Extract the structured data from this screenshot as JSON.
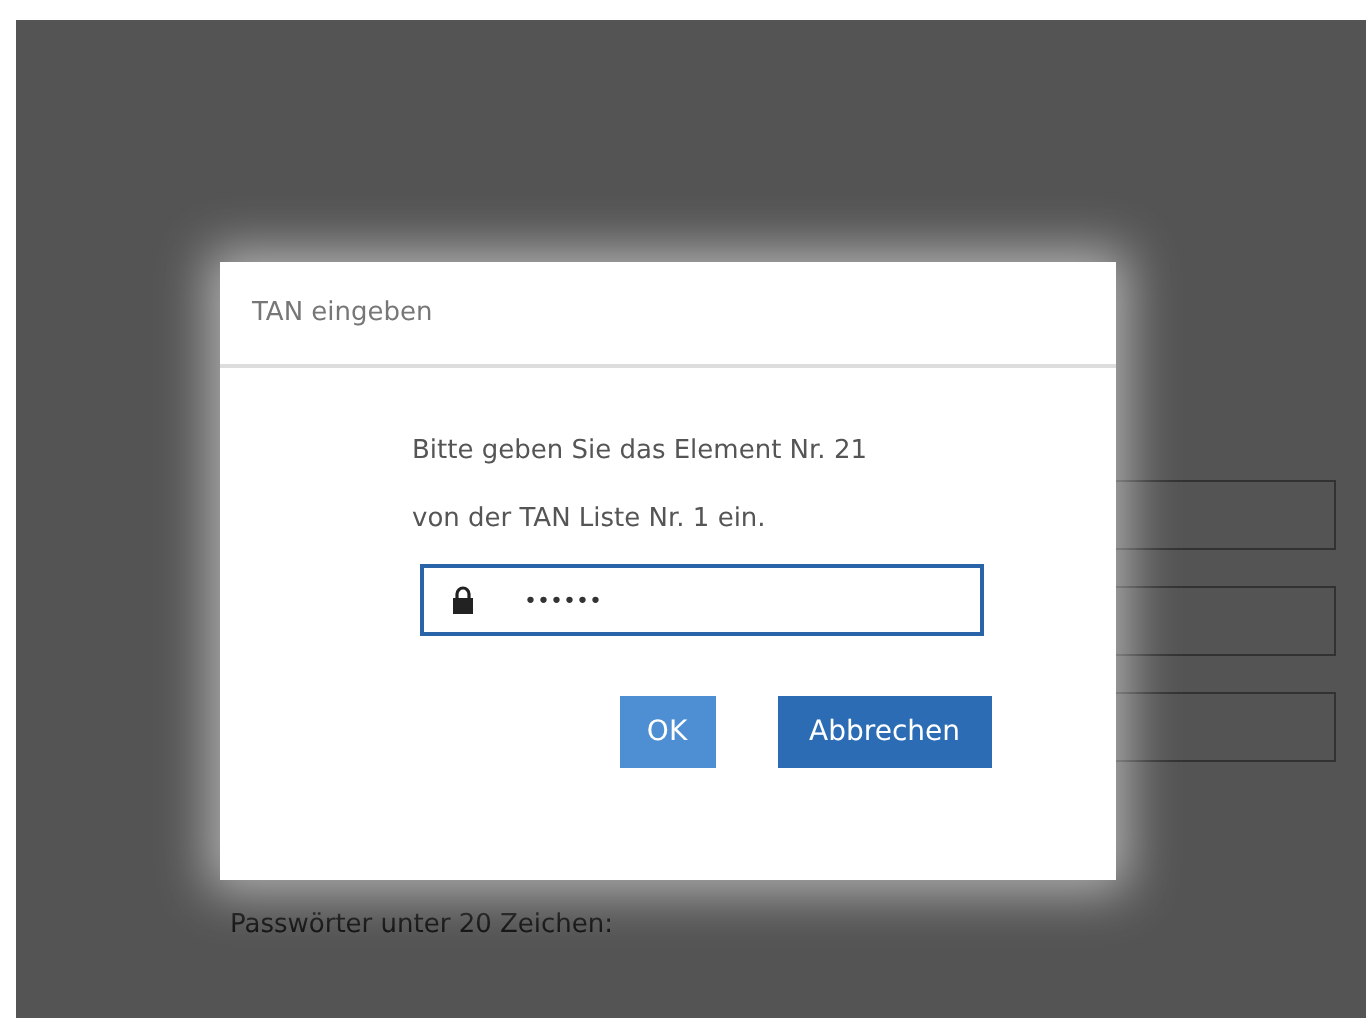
{
  "background_page": {
    "fields": [
      {
        "kind": "text"
      },
      {
        "kind": "text"
      },
      {
        "kind": "text"
      }
    ],
    "note": "Passwörter unter 20 Zeichen:"
  },
  "dialog": {
    "title": "TAN eingeben",
    "message_lines": [
      "Bitte geben Sie das Element Nr. 21",
      "von der TAN Liste Nr. 1 ein."
    ],
    "tan_field": {
      "value": "••••••",
      "focused": true
    },
    "buttons": [
      {
        "label": "OK",
        "kind": "secondary"
      },
      {
        "label": "Abbrechen",
        "kind": "primary"
      }
    ]
  }
}
